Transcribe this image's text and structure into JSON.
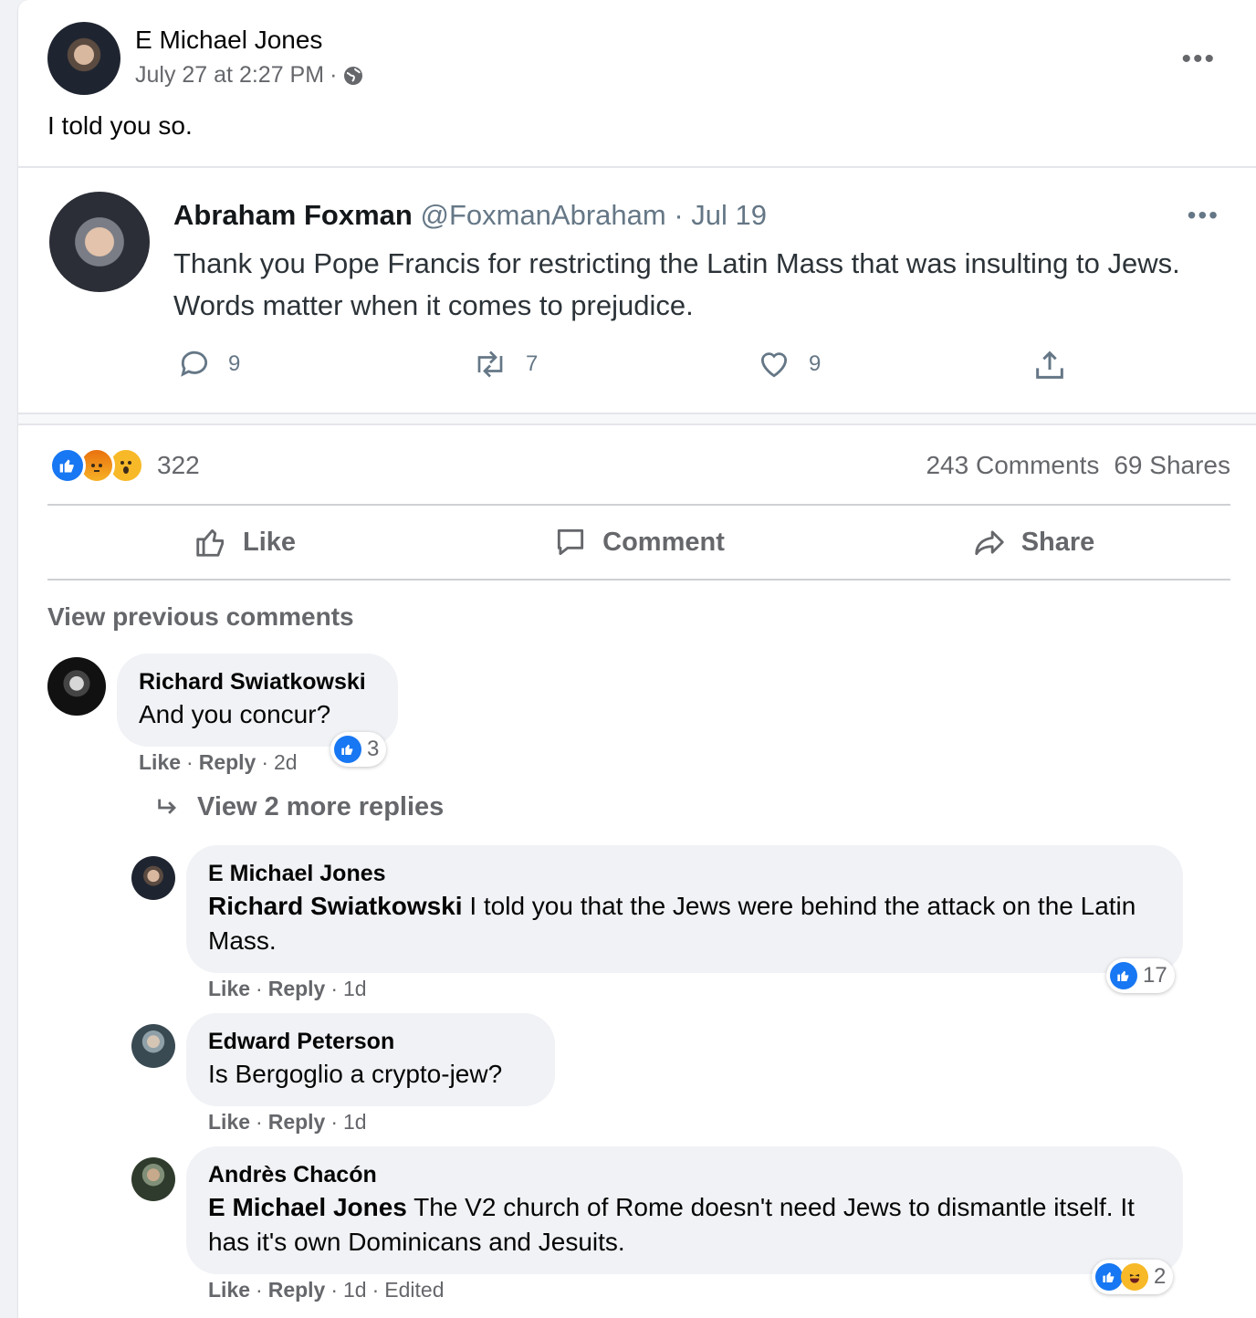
{
  "post": {
    "author": "E Michael Jones",
    "date": "July 27 at 2:27 PM",
    "separator": "·",
    "privacy_icon": "globe-icon",
    "text": "I told you so."
  },
  "tweet": {
    "name": "Abraham Foxman",
    "handle": "@FoxmanAbraham · Jul 19",
    "text": "Thank you Pope Francis for restricting the Latin Mass that was insulting to Jews. Words matter when it comes to prejudice.",
    "replies": "9",
    "retweets": "7",
    "likes": "9"
  },
  "stats": {
    "reaction_count": "322",
    "comments": "243 Comments",
    "shares": "69 Shares"
  },
  "actions": {
    "like": "Like",
    "comment": "Comment",
    "share": "Share"
  },
  "view_previous": "View previous comments",
  "view_more_replies": "View 2 more replies",
  "comments": [
    {
      "name": "Richard Swiatkowski",
      "mention": "",
      "text": "And you concur?",
      "like": "Like",
      "reply": "Reply",
      "age": "2d",
      "reactions": "3"
    },
    {
      "name": "E Michael Jones",
      "mention": "Richard Swiatkowski",
      "text": " I told you that the Jews were behind the attack on the Latin Mass.",
      "like": "Like",
      "reply": "Reply",
      "age": "1d",
      "reactions": "17"
    },
    {
      "name": "Edward Peterson",
      "mention": "",
      "text": "Is Bergoglio a crypto-jew?",
      "like": "Like",
      "reply": "Reply",
      "age": "1d",
      "reactions": ""
    },
    {
      "name": "Andrès Chacón",
      "mention": "E Michael Jones",
      "text": " The V2 church of Rome doesn't need Jews to dismantle itself. It has it's own Dominicans and Jesuits.",
      "like": "Like",
      "reply": "Reply",
      "age": "1d",
      "edited": "Edited",
      "reactions": "2"
    }
  ],
  "sep": "·",
  "colors": {
    "brand_blue": "#1877f2",
    "secondary_text": "#65676b",
    "bubble": "#f0f2f5"
  }
}
